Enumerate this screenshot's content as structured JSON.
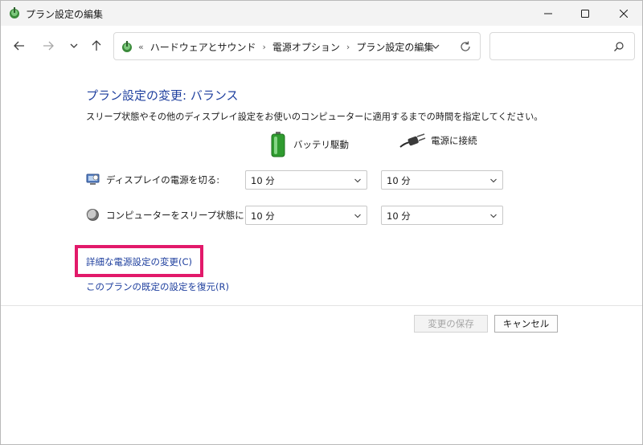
{
  "window": {
    "title": "プラン設定の編集"
  },
  "address": {
    "overflow": "«",
    "breadcrumbs": [
      "ハードウェアとサウンド",
      "電源オプション",
      "プラン設定の編集"
    ],
    "search_placeholder": ""
  },
  "main": {
    "heading": "プラン設定の変更: バランス",
    "description": "スリープ状態やその他のディスプレイ設定をお使いのコンピューターに適用するまでの時間を指定してください。",
    "columns": {
      "battery": "バッテリ駆動",
      "plugged": "電源に接続"
    },
    "settings": [
      {
        "label": "ディスプレイの電源を切る:",
        "battery_value": "10 分",
        "plugged_value": "10 分"
      },
      {
        "label": "コンピューターをスリープ状態にする:",
        "battery_value": "10 分",
        "plugged_value": "10 分"
      }
    ],
    "links": {
      "advanced": "詳細な電源設定の変更(C)",
      "restore": "このプランの既定の設定を復元(R)"
    }
  },
  "footer": {
    "save_label": "変更の保存",
    "cancel_label": "キャンセル"
  },
  "colors": {
    "link": "#1e3f9e",
    "highlight": "#e2196a"
  }
}
